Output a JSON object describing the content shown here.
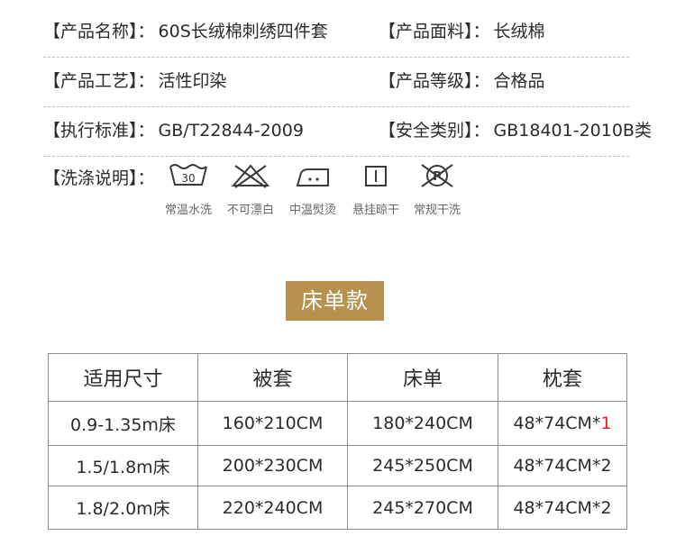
{
  "specs": [
    {
      "left": {
        "label": "【产品名称】：",
        "value": "60S长绒棉刺绣四件套"
      },
      "right": {
        "label": "【产品面料】：",
        "value": "长绒棉"
      }
    },
    {
      "left": {
        "label": "【产品工艺】：",
        "value": "活性印染"
      },
      "right": {
        "label": "【产品等级】：",
        "value": "合格品"
      }
    },
    {
      "left": {
        "label": "【执行标准】：",
        "value": "GB/T22844-2009"
      },
      "right": {
        "label": "【安全类别】：",
        "value": "GB18401-2010B类"
      }
    }
  ],
  "wash": {
    "label": "【洗涤说明】：",
    "items": [
      {
        "icon": "wash-30-icon",
        "temp": "30",
        "caption": "常温水洗"
      },
      {
        "icon": "no-bleach-icon",
        "caption": "不可漂白"
      },
      {
        "icon": "iron-medium-icon",
        "caption": "中温熨烫"
      },
      {
        "icon": "hang-dry-icon",
        "caption": "悬挂晾干"
      },
      {
        "icon": "dry-clean-p-icon",
        "letter": "P",
        "caption": "常规干洗"
      }
    ]
  },
  "section_title": "床单款",
  "size_table": {
    "headers": [
      "适用尺寸",
      "被套",
      "床单",
      "枕套"
    ],
    "rows": [
      {
        "size": "0.9-1.35m床",
        "duvet": "160*210CM",
        "sheet": "180*240CM",
        "pillow_main": "48*74CM*",
        "pillow_count": "1"
      },
      {
        "size": "1.5/1.8m床",
        "duvet": "200*230CM",
        "sheet": "245*250CM",
        "pillow_main": "48*74CM*",
        "pillow_count": "2"
      },
      {
        "size": "1.8/2.0m床",
        "duvet": "220*240CM",
        "sheet": "245*270CM",
        "pillow_main": "48*74CM*",
        "pillow_count": "2"
      }
    ]
  },
  "colors": {
    "accent": "#b7924f",
    "highlight_red": "#e0201c",
    "text": "#2b2b2b"
  }
}
